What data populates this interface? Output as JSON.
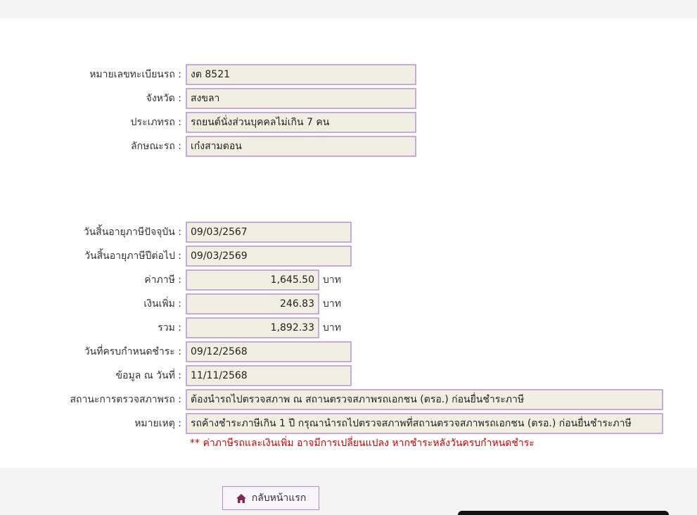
{
  "vehicle": {
    "plate_label": "หมายเลขทะเบียนรถ :",
    "plate_value": "งต 8521",
    "province_label": "จังหวัด :",
    "province_value": "สงขลา",
    "type_label": "ประเภทรถ :",
    "type_value": "รถยนต์นั่งส่วนบุคคลไม่เกิน 7 คน",
    "body_label": "ลักษณะรถ :",
    "body_value": "เก๋งสามตอน"
  },
  "tax": {
    "current_expiry_label": "วันสิ้นอายุภาษีปัจจุบัน :",
    "current_expiry_value": "09/03/2567",
    "next_expiry_label": "วันสิ้นอายุภาษีปีต่อไป :",
    "next_expiry_value": "09/03/2569",
    "tax_label": "ค่าภาษี :",
    "tax_value": "1,645.50",
    "surcharge_label": "เงินเพิ่ม :",
    "surcharge_value": "246.83",
    "total_label": "รวม :",
    "total_value": "1,892.33",
    "unit": "บาท",
    "due_date_label": "วันที่ครบกำหนดชำระ :",
    "due_date_value": "09/12/2568",
    "data_as_of_label": "ข้อมูล ณ วันที่ :",
    "data_as_of_value": "11/11/2568",
    "inspection_label": "สถานะการตรวจสภาพรถ :",
    "inspection_value": "ต้องนำรถไปตรวจสภาพ ณ สถานตรวจสภาพรถเอกชน (ตรอ.) ก่อนยื่นชำระภาษี",
    "remark_label": "หมายเหตุ :",
    "remark_value": "รถค้างชำระภาษีเกิน 1 ปี กรุณานำรถไปตรวจสภาพที่สถานตรวจสภาพรถเอกชน (ตรอ.) ก่อนยื่นชำระภาษี",
    "warning": "** ค่าภาษีรถและเงินเพิ่ม อาจมีการเปลี่ยนแปลง หากชำระหลังวันครบกำหนดชำระ"
  },
  "actions": {
    "home_label": "กลับหน้าแรก",
    "home_icon": "home-icon"
  }
}
